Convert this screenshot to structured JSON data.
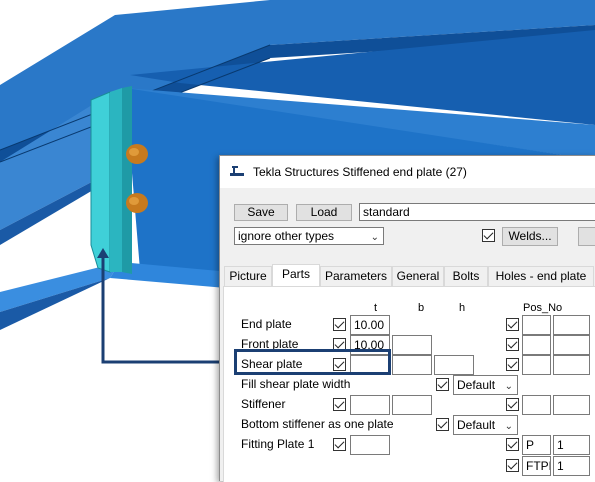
{
  "window": {
    "app": "Tekla Structures",
    "title": "Stiffened end plate (27)"
  },
  "toolbar": {
    "save_label": "Save",
    "load_label": "Load",
    "preset_value": "standard",
    "filter_value": "ignore other types",
    "welds_label": "Welds..."
  },
  "tabs": [
    "Picture",
    "Parts",
    "Parameters",
    "General",
    "Bolts",
    "Holes - end plate"
  ],
  "columns": {
    "t": "t",
    "b": "b",
    "h": "h",
    "pos": "Pos_No"
  },
  "rows": [
    {
      "label": "End plate",
      "t": "10.00"
    },
    {
      "label": "Front plate",
      "t": "10.00"
    },
    {
      "label": "Shear plate",
      "t": ""
    },
    {
      "label": "Fill shear plate width",
      "option": "Default"
    },
    {
      "label": "Stiffener",
      "t": ""
    },
    {
      "label": "Bottom stiffener as one plate",
      "option": "Default"
    },
    {
      "label": "Fitting Plate 1",
      "prefix": "P",
      "start": "1",
      "prefix2": "FTPL",
      "start2": "1"
    }
  ],
  "colors": {
    "steel_blue": "#1e6fc4",
    "plate_cyan": "#3fd0d8",
    "bolt_orange": "#c77a1e",
    "callout": "#1b3f73"
  }
}
